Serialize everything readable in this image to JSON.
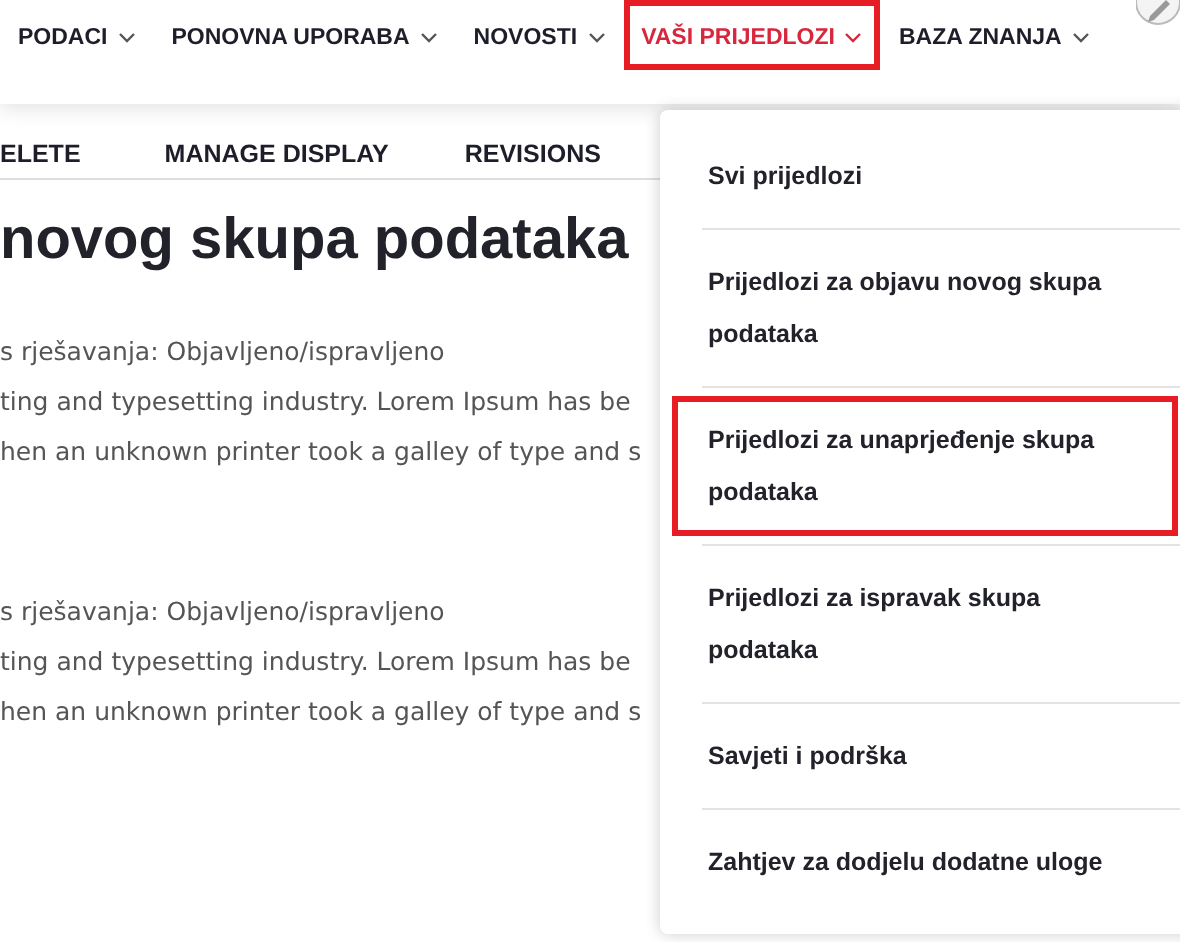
{
  "nav": {
    "items": [
      {
        "label": "PODACI",
        "selected": false,
        "highlighted": false
      },
      {
        "label": "PONOVNA UPORABA",
        "selected": false,
        "highlighted": false
      },
      {
        "label": "NOVOSTI",
        "selected": false,
        "highlighted": false
      },
      {
        "label": "VAŠI PRIJEDLOZI",
        "selected": true,
        "highlighted": true
      },
      {
        "label": "BAZA ZNANJA",
        "selected": false,
        "highlighted": false
      }
    ]
  },
  "tabs": [
    {
      "label": "ELETE"
    },
    {
      "label": "MANAGE DISPLAY"
    },
    {
      "label": "REVISIONS"
    }
  ],
  "title": "novog skupa podataka",
  "entries": [
    {
      "status": "s rješavanja: Objavljeno/ispravljeno",
      "lines": [
        "ting and typesetting industry. Lorem Ipsum has be",
        "hen an unknown printer took a galley of type and s"
      ]
    },
    {
      "status": "s rješavanja: Objavljeno/ispravljeno",
      "lines": [
        "ting and typesetting industry. Lorem Ipsum has be",
        "hen an unknown printer took a galley of type and s"
      ]
    }
  ],
  "dropdown": {
    "items": [
      {
        "label": "Svi prijedlozi",
        "highlighted": false
      },
      {
        "label": "Prijedlozi za objavu novog skupa podataka",
        "highlighted": false
      },
      {
        "label": "Prijedlozi za unaprjeđenje skupa podataka",
        "highlighted": true
      },
      {
        "label": "Prijedlozi za ispravak skupa podataka",
        "highlighted": false
      },
      {
        "label": "Savjeti i podrška",
        "highlighted": false
      },
      {
        "label": "Zahtjev za dodjelu dodatne uloge",
        "highlighted": false
      }
    ]
  }
}
